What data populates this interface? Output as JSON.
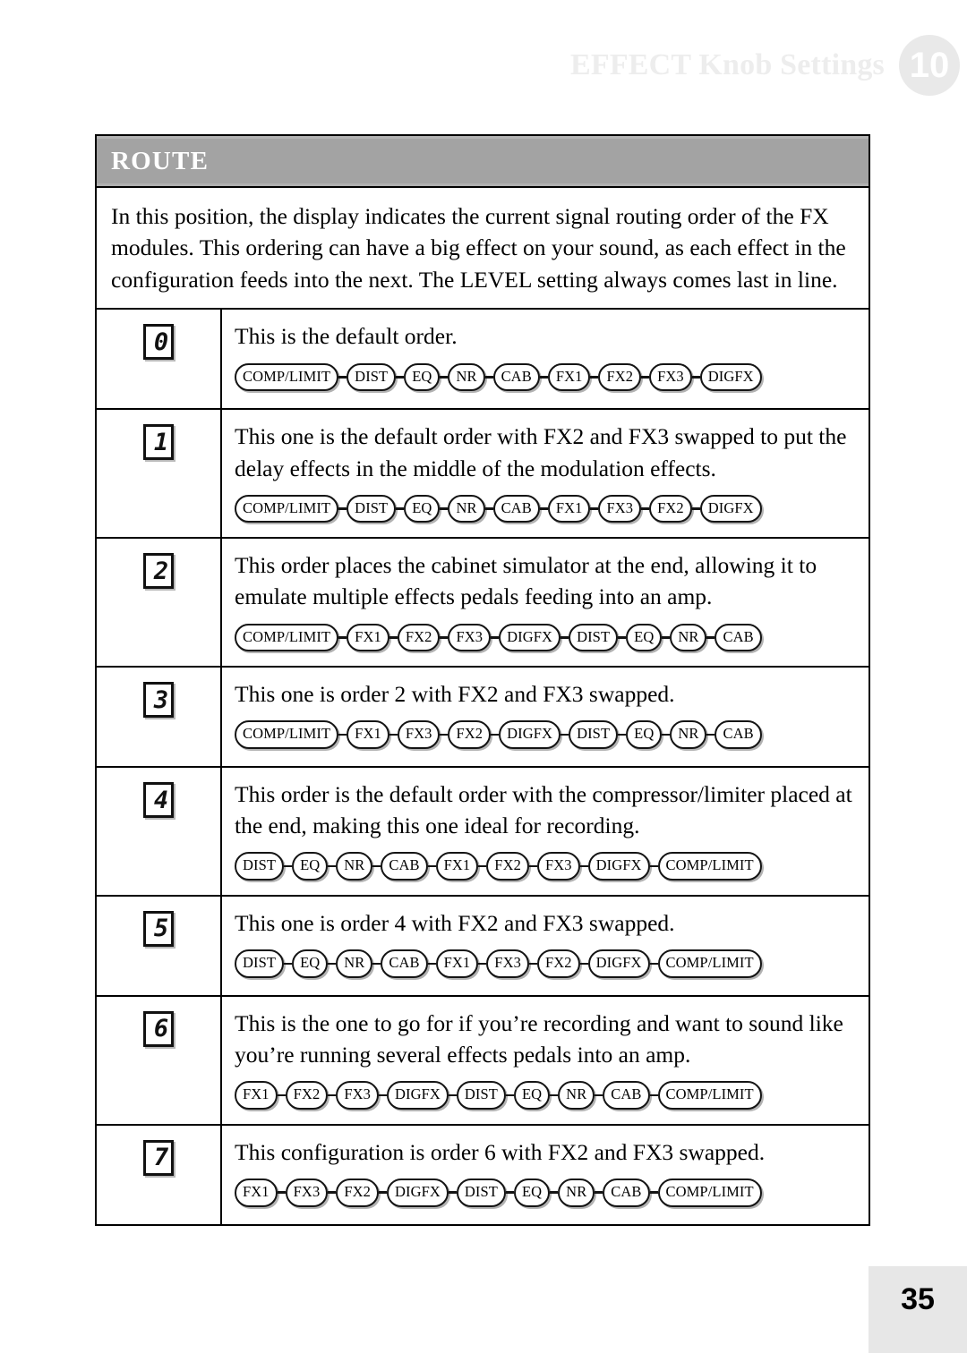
{
  "header": {
    "title": "EFFECT Knob Settings",
    "chapter_number": "10"
  },
  "section": {
    "band_title": "ROUTE",
    "intro": "In this position, the display indicates the current signal routing order of the FX modules. This ordering can have a big effect on your sound, as each effect in the configuration feeds into the next. The LEVEL setting always comes last in line."
  },
  "rows": [
    {
      "digit": "0",
      "description": "This is the default order.",
      "chain": [
        "COMP/LIMIT",
        "DIST",
        "EQ",
        "NR",
        "CAB",
        "FX1",
        "FX2",
        "FX3",
        "DIGFX"
      ]
    },
    {
      "digit": "1",
      "description": "This one is the default order with FX2 and FX3 swapped to put the delay effects in the middle of the modulation effects.",
      "chain": [
        "COMP/LIMIT",
        "DIST",
        "EQ",
        "NR",
        "CAB",
        "FX1",
        "FX3",
        "FX2",
        "DIGFX"
      ]
    },
    {
      "digit": "2",
      "description": "This order places the cabinet simulator at the end, allowing it to emulate multiple effects pedals feeding into an amp.",
      "chain": [
        "COMP/LIMIT",
        "FX1",
        "FX2",
        "FX3",
        "DIGFX",
        "DIST",
        "EQ",
        "NR",
        "CAB"
      ]
    },
    {
      "digit": "3",
      "description": "This one is order 2 with FX2 and FX3 swapped.",
      "chain": [
        "COMP/LIMIT",
        "FX1",
        "FX3",
        "FX2",
        "DIGFX",
        "DIST",
        "EQ",
        "NR",
        "CAB"
      ]
    },
    {
      "digit": "4",
      "description": "This order is the default order with the compressor/limiter placed at the end, making this one ideal for recording.",
      "chain": [
        "DIST",
        "EQ",
        "NR",
        "CAB",
        "FX1",
        "FX2",
        "FX3",
        "DIGFX",
        "COMP/LIMIT"
      ]
    },
    {
      "digit": "5",
      "description": "This one is order 4 with FX2 and FX3 swapped.",
      "chain": [
        "DIST",
        "EQ",
        "NR",
        "CAB",
        "FX1",
        "FX3",
        "FX2",
        "DIGFX",
        "COMP/LIMIT"
      ]
    },
    {
      "digit": "6",
      "description": "This is the one to go for if you’re recording and want to sound like you’re running several effects pedals into an amp.",
      "chain": [
        "FX1",
        "FX2",
        "FX3",
        "DIGFX",
        "DIST",
        "EQ",
        "NR",
        "CAB",
        "COMP/LIMIT"
      ]
    },
    {
      "digit": "7",
      "description": "This configuration is order 6 with FX2 and FX3 swapped.",
      "chain": [
        "FX1",
        "FX3",
        "FX2",
        "DIGFX",
        "DIST",
        "EQ",
        "NR",
        "CAB",
        "COMP/LIMIT"
      ]
    }
  ],
  "footer": {
    "page_number": "35"
  },
  "colors": {
    "band_gray": "#a3a3a3",
    "header_text_gray": "#ededed",
    "badge_gray": "#e9e9e9",
    "footer_gray": "#e7e7e7",
    "ink": "#000000"
  }
}
